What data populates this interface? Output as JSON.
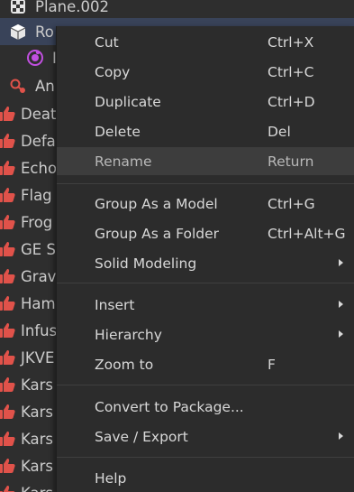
{
  "explorer": {
    "rows": [
      {
        "label": "Plane.002",
        "icon": "mesh-part-icon"
      },
      {
        "label": "Ro",
        "icon": "model-icon"
      },
      {
        "label": "I",
        "icon": "animation-controller-icon"
      },
      {
        "label": "An",
        "icon": "animator-icon"
      },
      {
        "label": "Deat",
        "icon": "thumbs-up-icon"
      },
      {
        "label": "Defa",
        "icon": "thumbs-up-icon"
      },
      {
        "label": "Echo",
        "icon": "thumbs-up-icon"
      },
      {
        "label": "Flag",
        "icon": "thumbs-up-icon"
      },
      {
        "label": "Frog",
        "icon": "thumbs-up-icon"
      },
      {
        "label": "GE S",
        "icon": "thumbs-up-icon"
      },
      {
        "label": "Grav",
        "icon": "thumbs-up-icon"
      },
      {
        "label": "Ham",
        "icon": "thumbs-up-icon"
      },
      {
        "label": "Infus",
        "icon": "thumbs-up-icon"
      },
      {
        "label": "JKVE",
        "icon": "thumbs-up-icon"
      },
      {
        "label": "Kars",
        "icon": "thumbs-up-icon"
      },
      {
        "label": "Kars",
        "icon": "thumbs-up-icon"
      },
      {
        "label": "Kars",
        "icon": "thumbs-up-icon"
      },
      {
        "label": "Kars",
        "icon": "thumbs-up-icon"
      },
      {
        "label": "Kars",
        "icon": "thumbs-up-icon"
      }
    ]
  },
  "context_menu": {
    "items": [
      {
        "label": "Cut",
        "shortcut": "Ctrl+X"
      },
      {
        "label": "Copy",
        "shortcut": "Ctrl+C"
      },
      {
        "label": "Duplicate",
        "shortcut": "Ctrl+D"
      },
      {
        "label": "Delete",
        "shortcut": "Del"
      },
      {
        "label": "Rename",
        "shortcut": "Return"
      },
      {
        "label": "Group As a Model",
        "shortcut": "Ctrl+G"
      },
      {
        "label": "Group As a Folder",
        "shortcut": "Ctrl+Alt+G"
      },
      {
        "label": "Solid Modeling",
        "shortcut": ""
      },
      {
        "label": "Insert",
        "shortcut": ""
      },
      {
        "label": "Hierarchy",
        "shortcut": ""
      },
      {
        "label": "Zoom to",
        "shortcut": "F"
      },
      {
        "label": "Convert to Package...",
        "shortcut": ""
      },
      {
        "label": "Save / Export",
        "shortcut": ""
      },
      {
        "label": "Help",
        "shortcut": ""
      }
    ]
  },
  "colors": {
    "background": "#2e2e2e",
    "selected_row": "#394359",
    "menu_background": "#2c2c2c",
    "menu_hover": "#3d3d3d",
    "icon_red": "#e0524a",
    "icon_purple": "#c14fe0"
  }
}
